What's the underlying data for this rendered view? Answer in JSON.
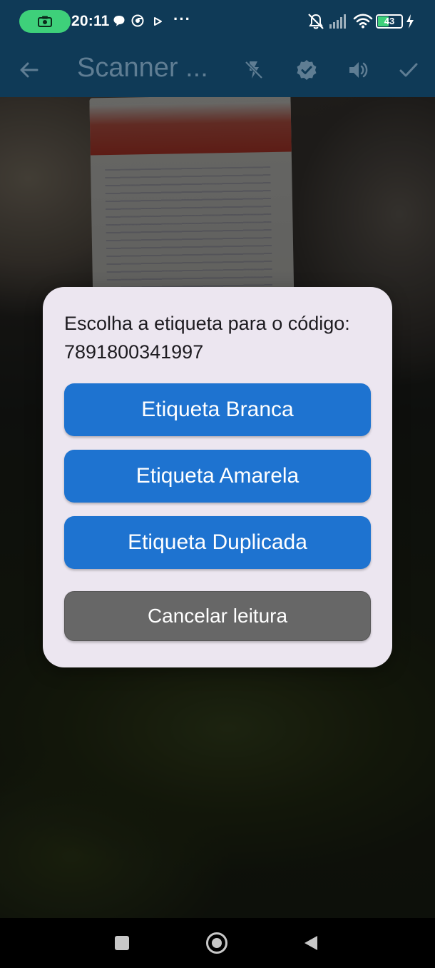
{
  "status_bar": {
    "time": "20:11",
    "battery_percent": "43",
    "more": "···",
    "icons": [
      "screen-record-icon",
      "chat-bubble-icon",
      "chrome-icon",
      "play-icon",
      "overflow-dots-icon",
      "vibrate-mute-icon",
      "signal-icon",
      "wifi-icon",
      "battery-icon",
      "charging-icon"
    ],
    "accent_color": "#3ed07a"
  },
  "app_bar": {
    "title": "Scanner ...",
    "background_color": "#0f3a57",
    "actions": [
      "back-arrow-icon",
      "flash-off-icon",
      "verified-icon",
      "volume-icon",
      "check-icon"
    ]
  },
  "dialog": {
    "message": "Escolha a etiqueta para o código: 7891800341997",
    "buttons": {
      "white_label": "Etiqueta Branca",
      "yellow_label": "Etiqueta Amarela",
      "duplicate_label": "Etiqueta Duplicada",
      "cancel_label": "Cancelar leitura"
    },
    "primary_color": "#1e73d0",
    "cancel_color": "#676767",
    "background_color": "#ece6f0"
  },
  "nav_bar": {
    "buttons": [
      "recents-icon",
      "home-icon",
      "back-icon"
    ]
  }
}
